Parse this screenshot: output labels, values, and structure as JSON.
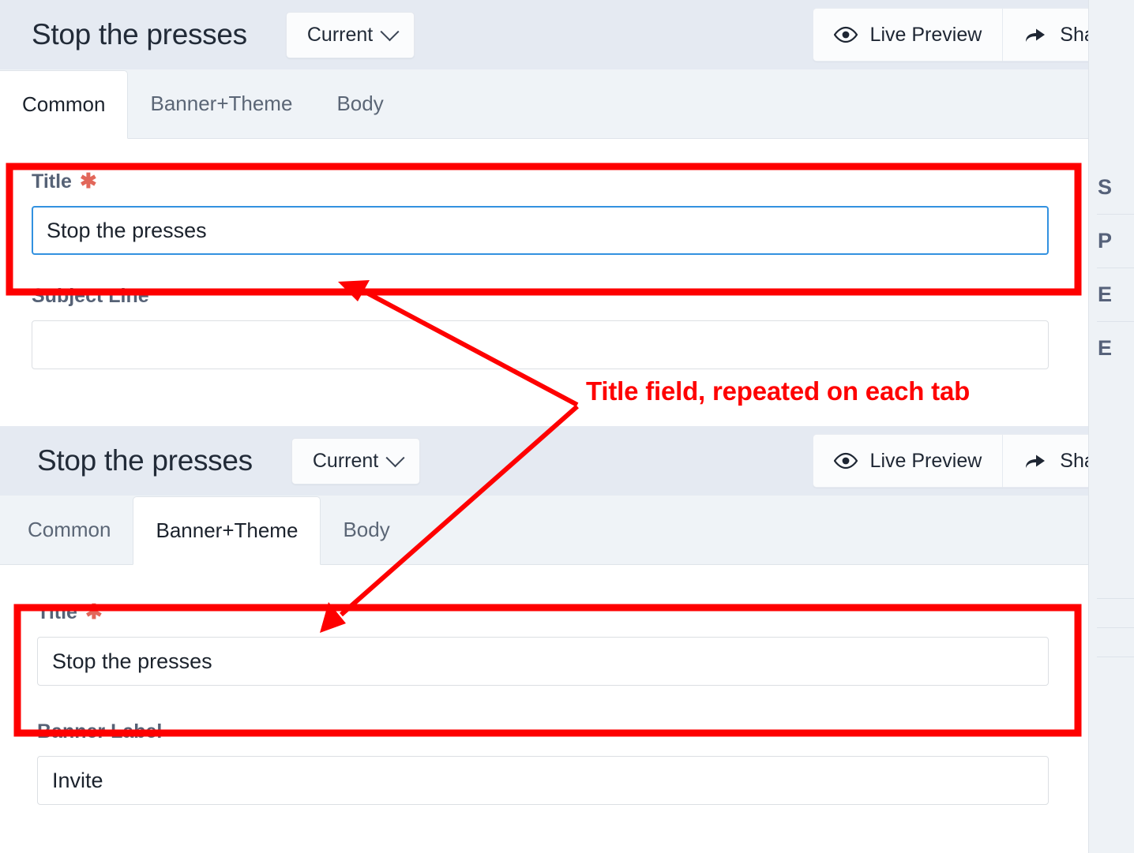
{
  "panels": [
    {
      "id": "common-panel",
      "header": {
        "doc_title": "Stop the presses",
        "version_button": "Current",
        "version_chevron_icon": "chevron-down-icon",
        "live_preview_label": "Live Preview",
        "live_preview_icon": "eye-icon",
        "share_label": "Share",
        "share_icon": "share-arrow-icon"
      },
      "tabs": [
        {
          "label": "Common",
          "active": true
        },
        {
          "label": "Banner+Theme",
          "active": false
        },
        {
          "label": "Body",
          "active": false
        }
      ],
      "fields": [
        {
          "label": "Title",
          "required_marker": "✱",
          "value": "Stop the presses",
          "placeholder": "",
          "focused": true
        },
        {
          "label": "Subject Line",
          "required_marker": "",
          "value": "",
          "placeholder": "",
          "focused": false
        }
      ],
      "side_rail_items": [
        "S",
        "P",
        "E",
        "E"
      ]
    },
    {
      "id": "banner-theme-panel",
      "header": {
        "doc_title": "Stop the presses",
        "version_button": "Current",
        "version_chevron_icon": "chevron-down-icon",
        "live_preview_label": "Live Preview",
        "live_preview_icon": "eye-icon",
        "share_label": "Share",
        "share_icon": "share-arrow-icon"
      },
      "tabs": [
        {
          "label": "Common",
          "active": false
        },
        {
          "label": "Banner+Theme",
          "active": true
        },
        {
          "label": "Body",
          "active": false
        }
      ],
      "fields": [
        {
          "label": "Title",
          "required_marker": "✱",
          "value": "Stop the presses",
          "placeholder": "",
          "focused": false
        },
        {
          "label": "Banner Label",
          "required_marker": "",
          "value": "Invite",
          "placeholder": "",
          "focused": false
        }
      ],
      "side_rail_items": [
        "",
        "",
        "",
        ""
      ]
    }
  ],
  "annotation": {
    "text": "Title field, repeated on each tab",
    "color": "#fe0000",
    "highlight_color": "#fe0000"
  },
  "colors": {
    "header_bg": "#e5eaf2",
    "tabbar_bg": "#eff3f7",
    "panel_bg": "#ffffff",
    "rail_dark": "#242d3c",
    "focus_blue": "#3291e0",
    "required_red": "#e2675a",
    "label_gray": "#566276"
  }
}
